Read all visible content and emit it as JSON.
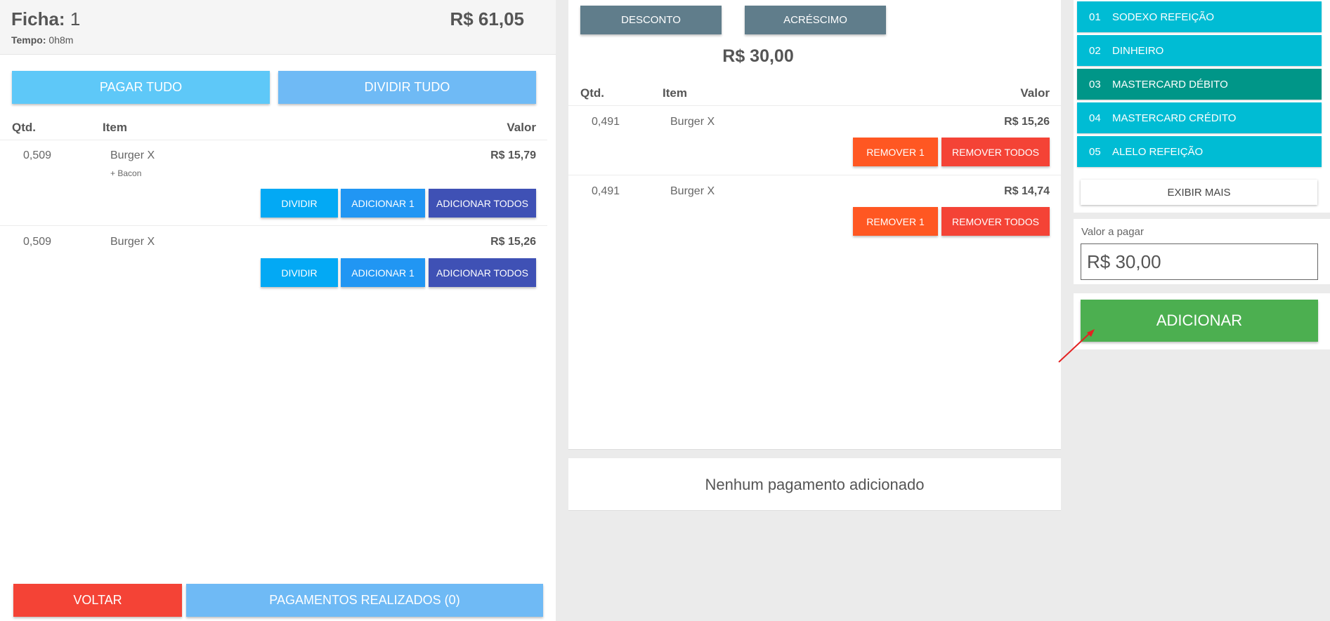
{
  "left": {
    "ficha_label": "Ficha:",
    "ficha_number": "1",
    "tempo_label": "Tempo:",
    "tempo_value": "0h8m",
    "total": "R$ 61,05",
    "pagar_tudo": "PAGAR TUDO",
    "dividir_tudo": "DIVIDIR TUDO",
    "columns": {
      "qty": "Qtd.",
      "item": "Item",
      "value": "Valor"
    },
    "items": [
      {
        "qty": "0,509",
        "name": "Burger X",
        "extra": "+ Bacon",
        "price": "R$ 15,79",
        "dividir": "DIVIDIR",
        "add_one": "ADICIONAR 1",
        "add_all": "ADICIONAR TODOS"
      },
      {
        "qty": "0,509",
        "name": "Burger X",
        "extra": "",
        "price": "R$ 15,26",
        "dividir": "DIVIDIR",
        "add_one": "ADICIONAR 1",
        "add_all": "ADICIONAR TODOS"
      }
    ],
    "voltar": "VOLTAR",
    "pagamentos_realizados": "PAGAMENTOS REALIZADOS (0)"
  },
  "middle": {
    "desconto": "DESCONTO",
    "acrescimo": "ACRÉSCIMO",
    "subtotal": "R$ 30,00",
    "columns": {
      "qty": "Qtd.",
      "item": "Item",
      "value": "Valor"
    },
    "items": [
      {
        "qty": "0,491",
        "name": "Burger X",
        "price": "R$ 15,26",
        "remove_one": "REMOVER 1",
        "remove_all": "REMOVER TODOS"
      },
      {
        "qty": "0,491",
        "name": "Burger X",
        "price": "R$ 14,74",
        "remove_one": "REMOVER 1",
        "remove_all": "REMOVER TODOS"
      }
    ],
    "no_payments": "Nenhum pagamento adicionado"
  },
  "right": {
    "payment_methods": [
      {
        "num": "01",
        "label": "SODEXO REFEIÇÃO",
        "selected": false
      },
      {
        "num": "02",
        "label": "DINHEIRO",
        "selected": false
      },
      {
        "num": "03",
        "label": "MASTERCARD DÉBITO",
        "selected": true
      },
      {
        "num": "04",
        "label": "MASTERCARD CRÉDITO",
        "selected": false
      },
      {
        "num": "05",
        "label": "ALELO REFEIÇÃO",
        "selected": false
      }
    ],
    "exibir_mais": "EXIBIR MAIS",
    "valor_label": "Valor a pagar",
    "valor_value": "R$ 30,00",
    "adicionar": "ADICIONAR"
  },
  "colors": {
    "light_blue": "#5ec8f8",
    "pale_blue": "#6fbaf5",
    "sky": "#03a9f4",
    "blue": "#2196f3",
    "indigo": "#3f51b5",
    "slate": "#607d8b",
    "deep_orange": "#ff5722",
    "red": "#f44336",
    "cyan": "#00bcd4",
    "teal": "#009688",
    "green": "#4caf50"
  }
}
